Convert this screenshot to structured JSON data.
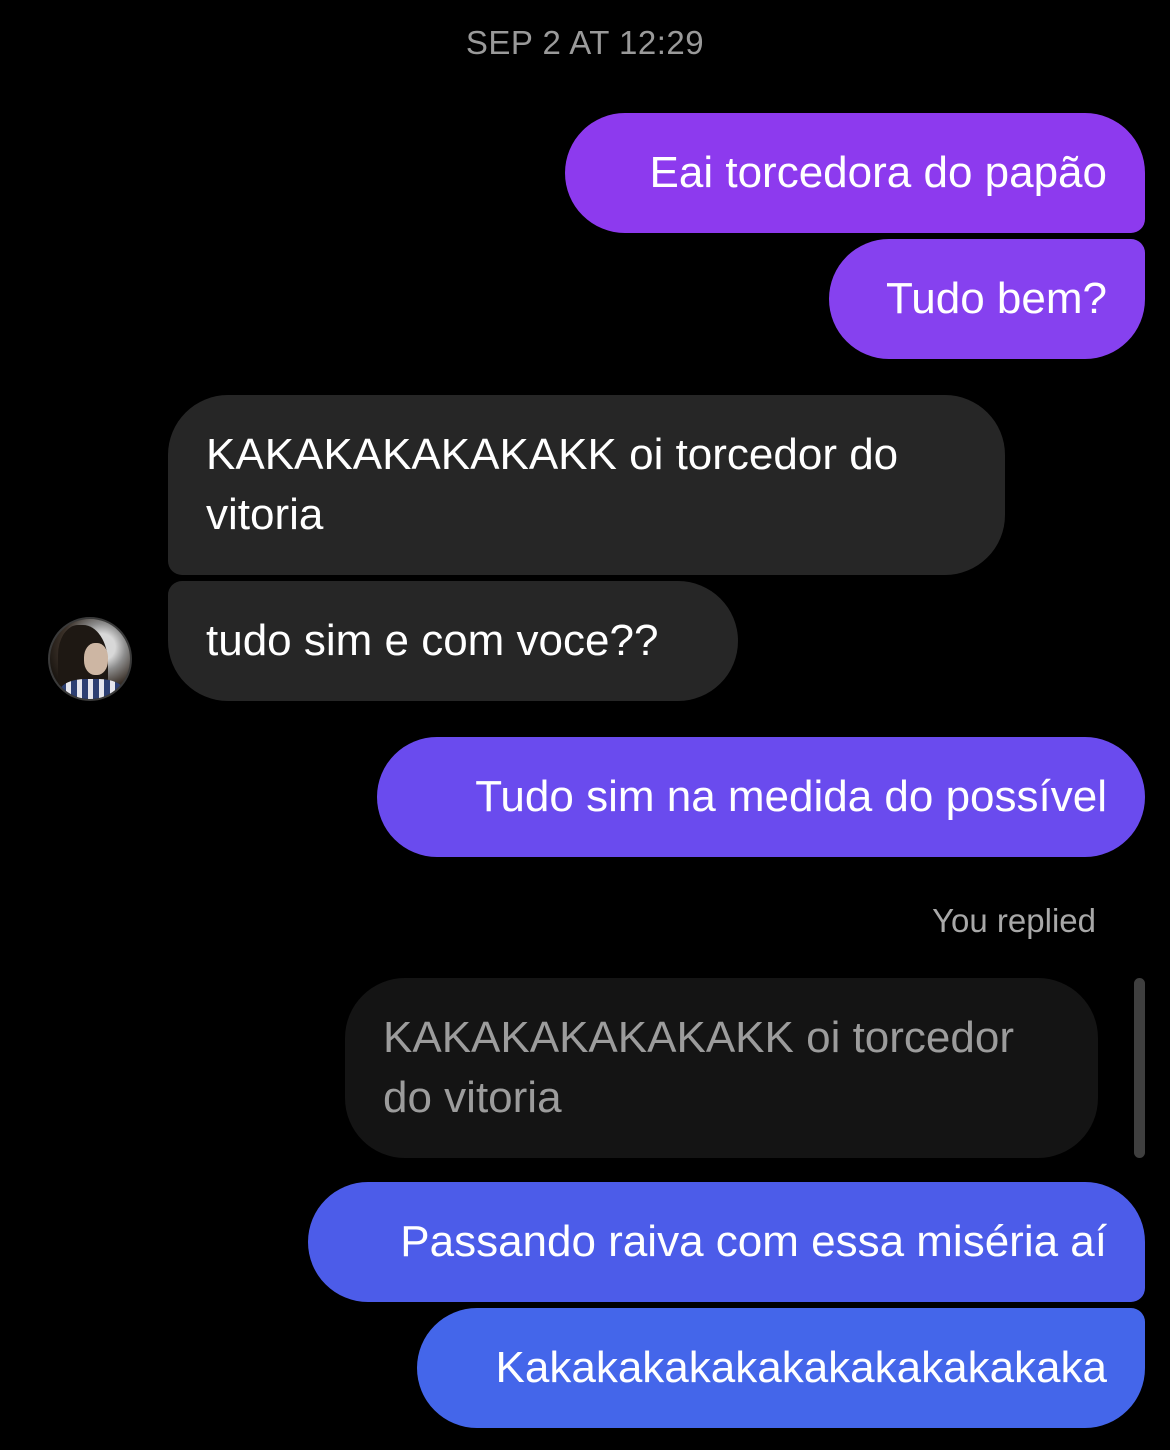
{
  "thread": {
    "timestamp": "SEP 2 AT 12:29",
    "messages": [
      {
        "direction": "outgoing",
        "text": "Eai torcedora do papão"
      },
      {
        "direction": "outgoing",
        "text": "Tudo bem?"
      },
      {
        "direction": "incoming",
        "text": "KAKAKAKAKAKAKK oi torcedor do vitoria"
      },
      {
        "direction": "incoming",
        "text": "tudo sim e com voce??"
      },
      {
        "direction": "outgoing",
        "text": "Tudo sim na medida do possível"
      },
      {
        "direction": "outgoing",
        "text": "Passando raiva com essa miséria aí"
      },
      {
        "direction": "outgoing",
        "text": "Kakakakakakakakakakakakaka"
      }
    ],
    "reply": {
      "label": "You replied",
      "quoted_text": "KAKAKAKAKAKAKK oi torcedor do vitoria"
    }
  },
  "avatar": {
    "icon": "profile-photo"
  },
  "colors": {
    "background": "#000000",
    "incoming_bubble": "#262626",
    "quoted_bubble": "#141414",
    "outgoing_top": "#8d3aee",
    "outgoing_mid": "#6a4bee",
    "outgoing_bottom": "#4466ea",
    "timestamp_text": "#9a9a9a"
  }
}
